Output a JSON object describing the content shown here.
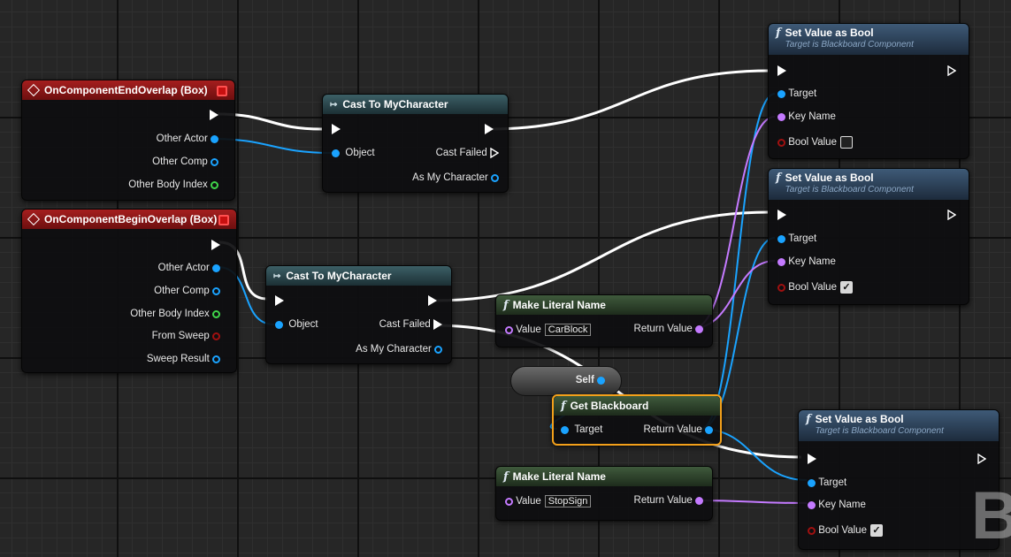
{
  "nodes": {
    "end_overlap": {
      "title": "OnComponentEndOverlap (Box)",
      "pins": [
        "Other Actor",
        "Other Comp",
        "Other Body Index"
      ]
    },
    "begin_overlap": {
      "title": "OnComponentBeginOverlap (Box)",
      "pins": [
        "Other Actor",
        "Other Comp",
        "Other Body Index",
        "From Sweep",
        "Sweep Result"
      ]
    },
    "cast_1": {
      "title": "Cast To MyCharacter",
      "object": "Object",
      "cast_failed": "Cast Failed",
      "as_char": "As My Character"
    },
    "cast_2": {
      "title": "Cast To MyCharacter",
      "object": "Object",
      "cast_failed": "Cast Failed",
      "as_char": "As My Character"
    },
    "set_bool_1": {
      "title": "Set Value as Bool",
      "subtitle": "Target is Blackboard Component",
      "target": "Target",
      "key": "Key Name",
      "bool": "Bool Value",
      "bool_checked": false
    },
    "set_bool_2": {
      "title": "Set Value as Bool",
      "subtitle": "Target is Blackboard Component",
      "target": "Target",
      "key": "Key Name",
      "bool": "Bool Value",
      "bool_checked": true
    },
    "set_bool_3": {
      "title": "Set Value as Bool",
      "subtitle": "Target is Blackboard Component",
      "target": "Target",
      "key": "Key Name",
      "bool": "Bool Value",
      "bool_checked": true
    },
    "literal_1": {
      "title": "Make Literal Name",
      "value_label": "Value",
      "value": "CarBlock",
      "return": "Return Value"
    },
    "literal_2": {
      "title": "Make Literal Name",
      "value_label": "Value",
      "value": "StopSign",
      "return": "Return Value"
    },
    "self": {
      "label": "Self"
    },
    "get_blackboard": {
      "title": "Get Blackboard",
      "target": "Target",
      "return": "Return Value"
    }
  },
  "watermark": "B",
  "colors": {
    "exec_wire": "#ffffff",
    "object_wire": "#1aa3ff",
    "name_wire": "#c47aff",
    "event_header": "#a51e1e",
    "selection": "#f3a01a"
  }
}
